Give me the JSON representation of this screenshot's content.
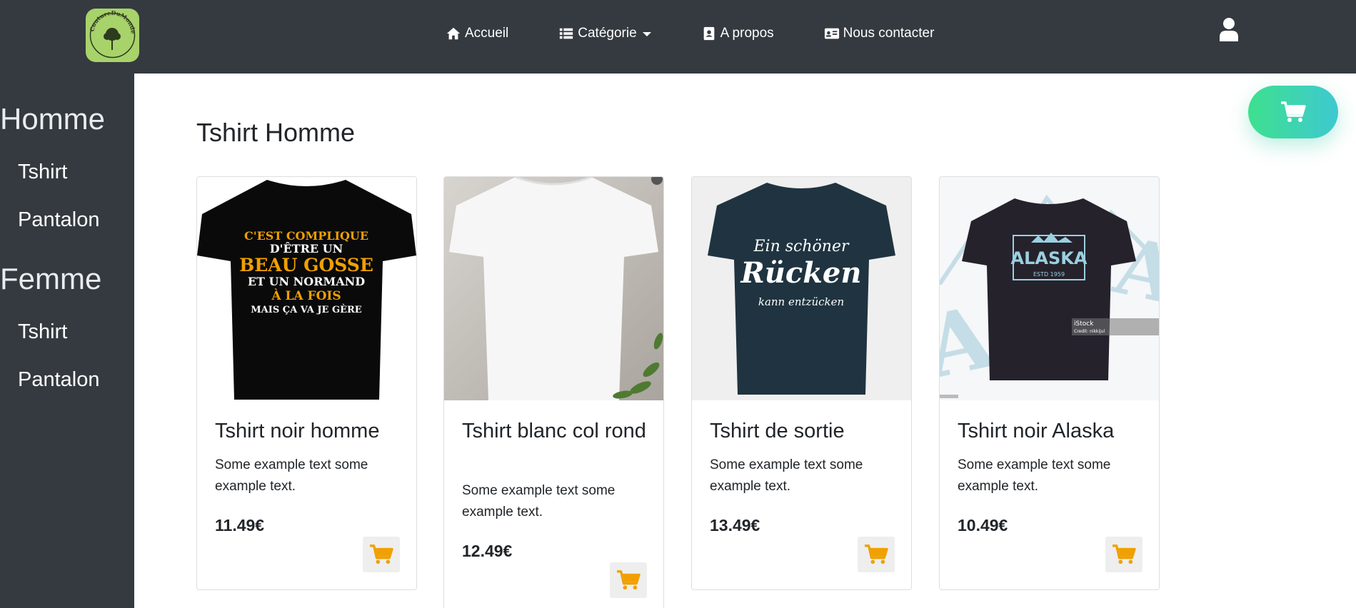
{
  "brand": {
    "logo_text": "CoutureDuMonde"
  },
  "nav": {
    "home": "Accueil",
    "category": "Catégorie",
    "about": "A propos",
    "contact": "Nous contacter"
  },
  "sidebar": {
    "groups": [
      {
        "title": "Homme",
        "items": [
          "Tshirt",
          "Pantalon"
        ]
      },
      {
        "title": "Femme",
        "items": [
          "Tshirt",
          "Pantalon"
        ]
      }
    ]
  },
  "main": {
    "title": "Tshirt Homme",
    "products": [
      {
        "name": "Tshirt noir homme",
        "description": "Some example text some example text.",
        "price": "11.49€",
        "shirt_print": [
          "C'EST COMPLIQUE",
          "D'ÊTRE UN",
          "BEAU GOSSE",
          "ET UN NORMAND",
          "À LA FOIS",
          "MAIS ÇA VA JE GÈRE"
        ]
      },
      {
        "name": "Tshirt blanc col rond",
        "description": "Some example text some example text.",
        "price": "12.49€"
      },
      {
        "name": "Tshirt de sortie",
        "description": "Some example text some example text.",
        "price": "13.49€",
        "shirt_print": [
          "Ein schöner",
          "Rücken",
          "kann entzücken"
        ]
      },
      {
        "name": "Tshirt noir Alaska",
        "description": "Some example text some example text.",
        "price": "10.49€",
        "shirt_print": [
          "ALASKA",
          "ESTD 1959"
        ],
        "watermark": [
          "iStock",
          "Credit: nikkijul"
        ]
      }
    ]
  },
  "colors": {
    "navbar": "#343a40",
    "cart_icon": "#f0a000",
    "float_cart_start": "#3ee08f",
    "float_cart_end": "#3ec9d0"
  }
}
